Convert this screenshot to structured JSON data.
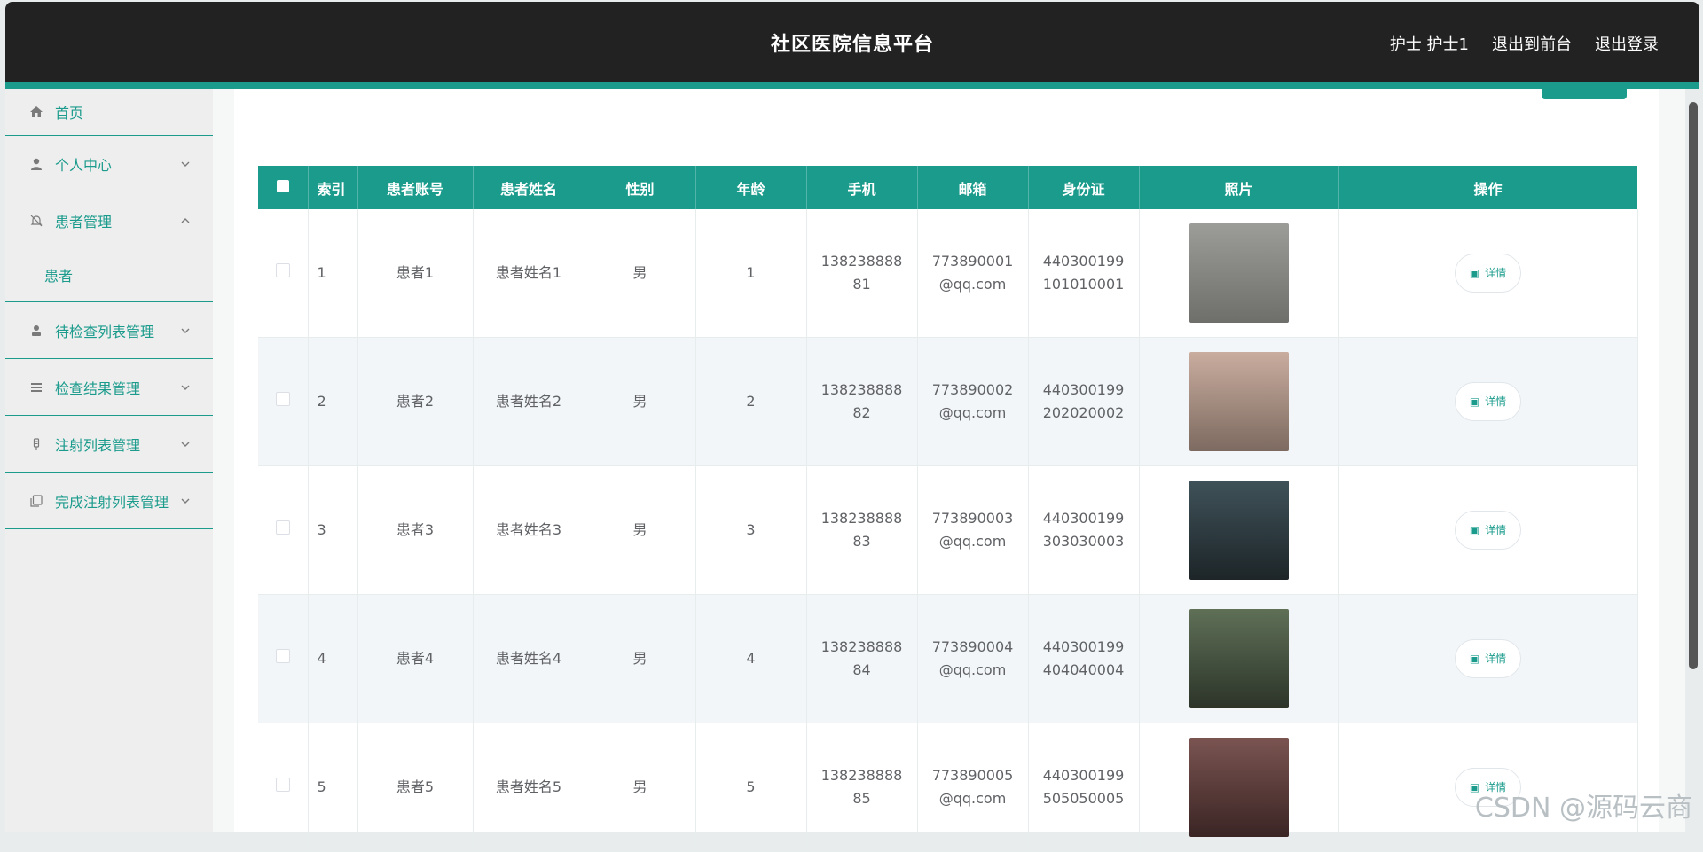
{
  "header": {
    "title": "社区医院信息平台",
    "user_label": "护士 护士1",
    "to_front": "退出到前台",
    "logout": "退出登录"
  },
  "sidebar": {
    "items": [
      {
        "label": "首页",
        "icon": "home-icon"
      },
      {
        "label": "个人中心",
        "icon": "user-icon"
      },
      {
        "label": "患者管理",
        "icon": "bell-off-icon",
        "expanded": true,
        "sub": [
          "患者"
        ]
      },
      {
        "label": "待检查列表管理",
        "icon": "person-icon"
      },
      {
        "label": "检查结果管理",
        "icon": "list-icon"
      },
      {
        "label": "注射列表管理",
        "icon": "syringe-icon"
      },
      {
        "label": "完成注射列表管理",
        "icon": "copy-icon"
      }
    ]
  },
  "table": {
    "headers": [
      "索引",
      "患者账号",
      "患者姓名",
      "性别",
      "年龄",
      "手机",
      "邮箱",
      "身份证",
      "照片",
      "操作"
    ],
    "detail_label": "详情",
    "rows": [
      {
        "index": "1",
        "account": "患者1",
        "name": "患者姓名1",
        "gender": "男",
        "age": "1",
        "phone": "13823888881",
        "email": "773890001@qq.com",
        "idcard": "440300199101010001",
        "photo_color": "#8a8a86"
      },
      {
        "index": "2",
        "account": "患者2",
        "name": "患者姓名2",
        "gender": "男",
        "age": "2",
        "phone": "13823888882",
        "email": "773890002@qq.com",
        "idcard": "440300199202020002",
        "photo_color": "#b79a8c"
      },
      {
        "index": "3",
        "account": "患者3",
        "name": "患者姓名3",
        "gender": "男",
        "age": "3",
        "phone": "13823888883",
        "email": "773890003@qq.com",
        "idcard": "440300199303030003",
        "photo_color": "#2f3e44"
      },
      {
        "index": "4",
        "account": "患者4",
        "name": "患者姓名4",
        "gender": "男",
        "age": "4",
        "phone": "13823888884",
        "email": "773890004@qq.com",
        "idcard": "440300199404040004",
        "photo_color": "#4b5a44"
      },
      {
        "index": "5",
        "account": "患者5",
        "name": "患者姓名5",
        "gender": "男",
        "age": "5",
        "phone": "13823888885",
        "email": "773890005@qq.com",
        "idcard": "440300199505050005",
        "photo_color": "#5a3c3a"
      }
    ]
  },
  "watermark": "CSDN @源码云商",
  "colors": {
    "accent": "#1a9b8c",
    "header_bg": "#222222"
  }
}
